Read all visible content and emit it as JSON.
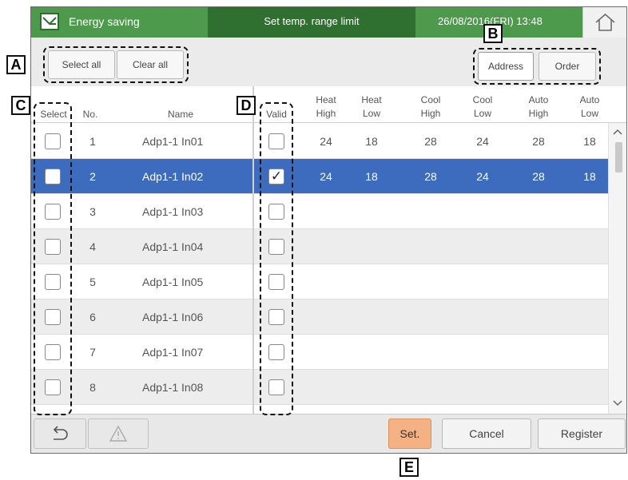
{
  "header": {
    "app_name": "Energy saving",
    "title": "Set temp. range limit",
    "datetime": "26/08/2016(FRI) 13:48"
  },
  "toolbar": {
    "select_all": "Select all",
    "clear_all": "Clear all",
    "address": "Address",
    "order": "Order"
  },
  "columns": {
    "select": "Select",
    "no": "No.",
    "name": "Name",
    "valid": "Valid",
    "heat_high": [
      "Heat",
      "High"
    ],
    "heat_low": [
      "Heat",
      "Low"
    ],
    "cool_high": [
      "Cool",
      "High"
    ],
    "cool_low": [
      "Cool",
      "Low"
    ],
    "auto_high": [
      "Auto",
      "High"
    ],
    "auto_low": [
      "Auto",
      "Low"
    ]
  },
  "rows": [
    {
      "no": "1",
      "name": "Adp1-1 In01",
      "selected": false,
      "valid": false,
      "heat_high": "24",
      "heat_low": "18",
      "cool_high": "28",
      "cool_low": "24",
      "auto_high": "28",
      "auto_low": "18"
    },
    {
      "no": "2",
      "name": "Adp1-1 In02",
      "selected": true,
      "valid": true,
      "heat_high": "24",
      "heat_low": "18",
      "cool_high": "28",
      "cool_low": "24",
      "auto_high": "28",
      "auto_low": "18"
    },
    {
      "no": "3",
      "name": "Adp1-1 In03",
      "selected": false,
      "valid": false,
      "heat_high": "",
      "heat_low": "",
      "cool_high": "",
      "cool_low": "",
      "auto_high": "",
      "auto_low": ""
    },
    {
      "no": "4",
      "name": "Adp1-1 In04",
      "selected": false,
      "valid": false,
      "heat_high": "",
      "heat_low": "",
      "cool_high": "",
      "cool_low": "",
      "auto_high": "",
      "auto_low": ""
    },
    {
      "no": "5",
      "name": "Adp1-1 In05",
      "selected": false,
      "valid": false,
      "heat_high": "",
      "heat_low": "",
      "cool_high": "",
      "cool_low": "",
      "auto_high": "",
      "auto_low": ""
    },
    {
      "no": "6",
      "name": "Adp1-1 In06",
      "selected": false,
      "valid": false,
      "heat_high": "",
      "heat_low": "",
      "cool_high": "",
      "cool_low": "",
      "auto_high": "",
      "auto_low": ""
    },
    {
      "no": "7",
      "name": "Adp1-1 In07",
      "selected": false,
      "valid": false,
      "heat_high": "",
      "heat_low": "",
      "cool_high": "",
      "cool_low": "",
      "auto_high": "",
      "auto_low": ""
    },
    {
      "no": "8",
      "name": "Adp1-1 In08",
      "selected": false,
      "valid": false,
      "heat_high": "",
      "heat_low": "",
      "cool_high": "",
      "cool_low": "",
      "auto_high": "",
      "auto_low": ""
    }
  ],
  "footer": {
    "set": "Set.",
    "cancel": "Cancel",
    "register": "Register"
  },
  "annotations": {
    "a": "A",
    "b": "B",
    "c": "C",
    "d": "D",
    "e": "E"
  },
  "icons": {
    "header": "energy-saving-icon",
    "home": "home-icon",
    "back": "back-arrow-icon",
    "warning": "warning-icon",
    "scroll_up": "chevron-up-icon",
    "scroll_down": "chevron-down-icon",
    "check": "checkmark-icon"
  },
  "colors": {
    "header_green": "#4e9a4c",
    "header_title_green": "#2f6f2f",
    "selected_row_blue": "#3d6cbf",
    "set_button_orange": "#f4b183"
  }
}
